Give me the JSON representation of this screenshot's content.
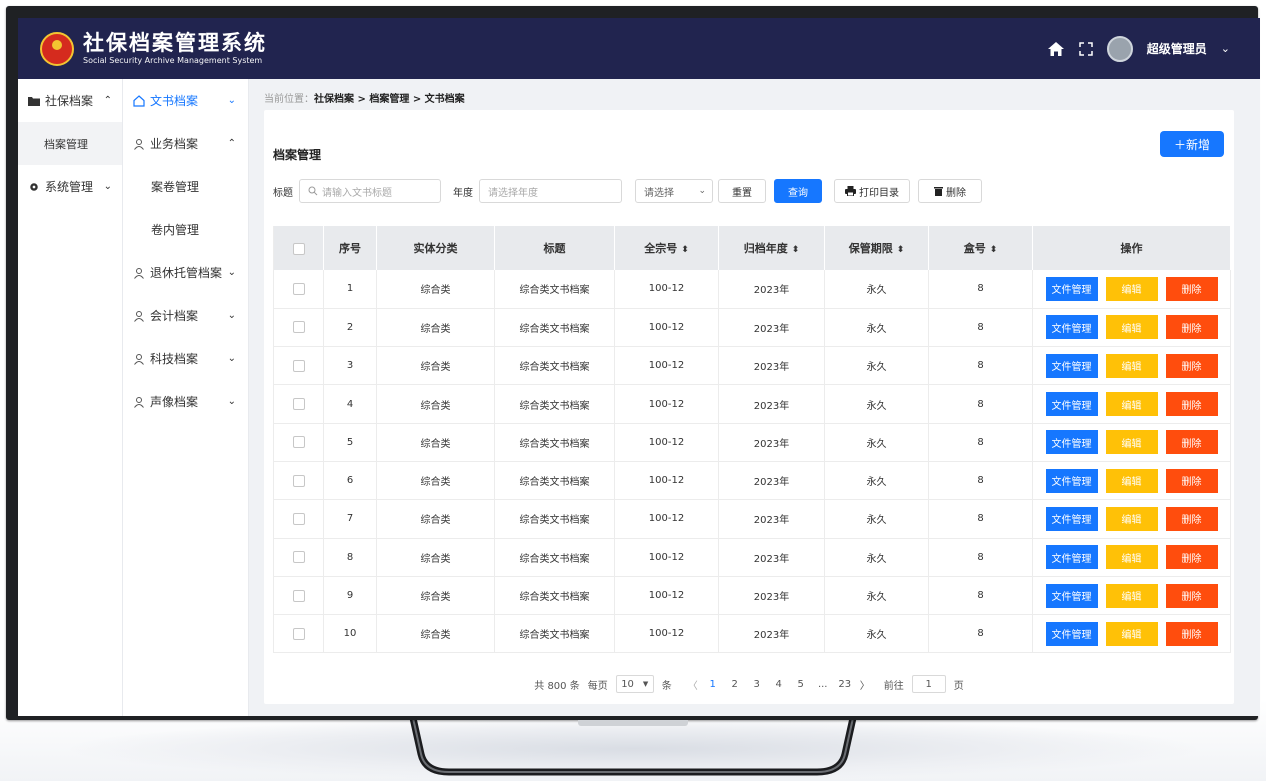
{
  "header": {
    "title": "社保档案管理系统",
    "subtitle": "Social Security Archive Management System",
    "username": "超级管理员"
  },
  "nav1": {
    "group1": "社保档案",
    "sub1": "档案管理",
    "group2": "系统管理"
  },
  "nav2": {
    "items": [
      {
        "label": "文书档案",
        "chev": "⌄"
      },
      {
        "label": "业务档案",
        "chev": "⌃"
      },
      {
        "label": "案卷管理"
      },
      {
        "label": "卷内管理"
      },
      {
        "label": "退休托管档案",
        "chev": "⌄"
      },
      {
        "label": "会计档案",
        "chev": "⌄"
      },
      {
        "label": "科技档案",
        "chev": "⌄"
      },
      {
        "label": "声像档案",
        "chev": "⌄"
      }
    ]
  },
  "breadcrumb": {
    "prefix": "当前位置：",
    "path": "社保档案 > 档案管理 > 文书档案"
  },
  "panel": {
    "title": "档案管理",
    "add_label": "＋新增"
  },
  "filters": {
    "title_label": "标题",
    "title_placeholder": "请输入文书标题",
    "year_label": "年度",
    "year_placeholder": "请选择年度",
    "select_value": "请选择",
    "reset_label": "重置",
    "query_label": "查询",
    "print_label": "打印目录",
    "delete_label": "删除"
  },
  "table": {
    "headers": [
      "序号",
      "实体分类",
      "标题",
      "全宗号",
      "归档年度",
      "保管期限",
      "盒号",
      "操作"
    ],
    "rows": [
      {
        "no": "1",
        "category": "综合类",
        "title": "综合类文书档案",
        "fonds": "100-12",
        "year": "2023年",
        "term": "永久",
        "box": "8"
      },
      {
        "no": "2",
        "category": "综合类",
        "title": "综合类文书档案",
        "fonds": "100-12",
        "year": "2023年",
        "term": "永久",
        "box": "8"
      },
      {
        "no": "3",
        "category": "综合类",
        "title": "综合类文书档案",
        "fonds": "100-12",
        "year": "2023年",
        "term": "永久",
        "box": "8"
      },
      {
        "no": "4",
        "category": "综合类",
        "title": "综合类文书档案",
        "fonds": "100-12",
        "year": "2023年",
        "term": "永久",
        "box": "8"
      },
      {
        "no": "5",
        "category": "综合类",
        "title": "综合类文书档案",
        "fonds": "100-12",
        "year": "2023年",
        "term": "永久",
        "box": "8"
      },
      {
        "no": "6",
        "category": "综合类",
        "title": "综合类文书档案",
        "fonds": "100-12",
        "year": "2023年",
        "term": "永久",
        "box": "8"
      },
      {
        "no": "7",
        "category": "综合类",
        "title": "综合类文书档案",
        "fonds": "100-12",
        "year": "2023年",
        "term": "永久",
        "box": "8"
      },
      {
        "no": "8",
        "category": "综合类",
        "title": "综合类文书档案",
        "fonds": "100-12",
        "year": "2023年",
        "term": "永久",
        "box": "8"
      },
      {
        "no": "9",
        "category": "综合类",
        "title": "综合类文书档案",
        "fonds": "100-12",
        "year": "2023年",
        "term": "永久",
        "box": "8"
      },
      {
        "no": "10",
        "category": "综合类",
        "title": "综合类文书档案",
        "fonds": "100-12",
        "year": "2023年",
        "term": "永久",
        "box": "8"
      }
    ],
    "ops": {
      "file": "文件管理",
      "edit": "编辑",
      "delete": "删除"
    }
  },
  "pagination": {
    "total": "共 800 条",
    "per_page_prefix": "每页",
    "per_page": "10",
    "per_page_suffix": "条",
    "pages": [
      "1",
      "2",
      "3",
      "4",
      "5",
      "...",
      "23"
    ],
    "goto_prefix": "前往",
    "goto_value": "1",
    "goto_suffix": "页"
  },
  "colors": {
    "header_bg": "#21244f",
    "primary": "#1677ff",
    "warning": "#ffc107",
    "danger": "#ff4d0d"
  }
}
